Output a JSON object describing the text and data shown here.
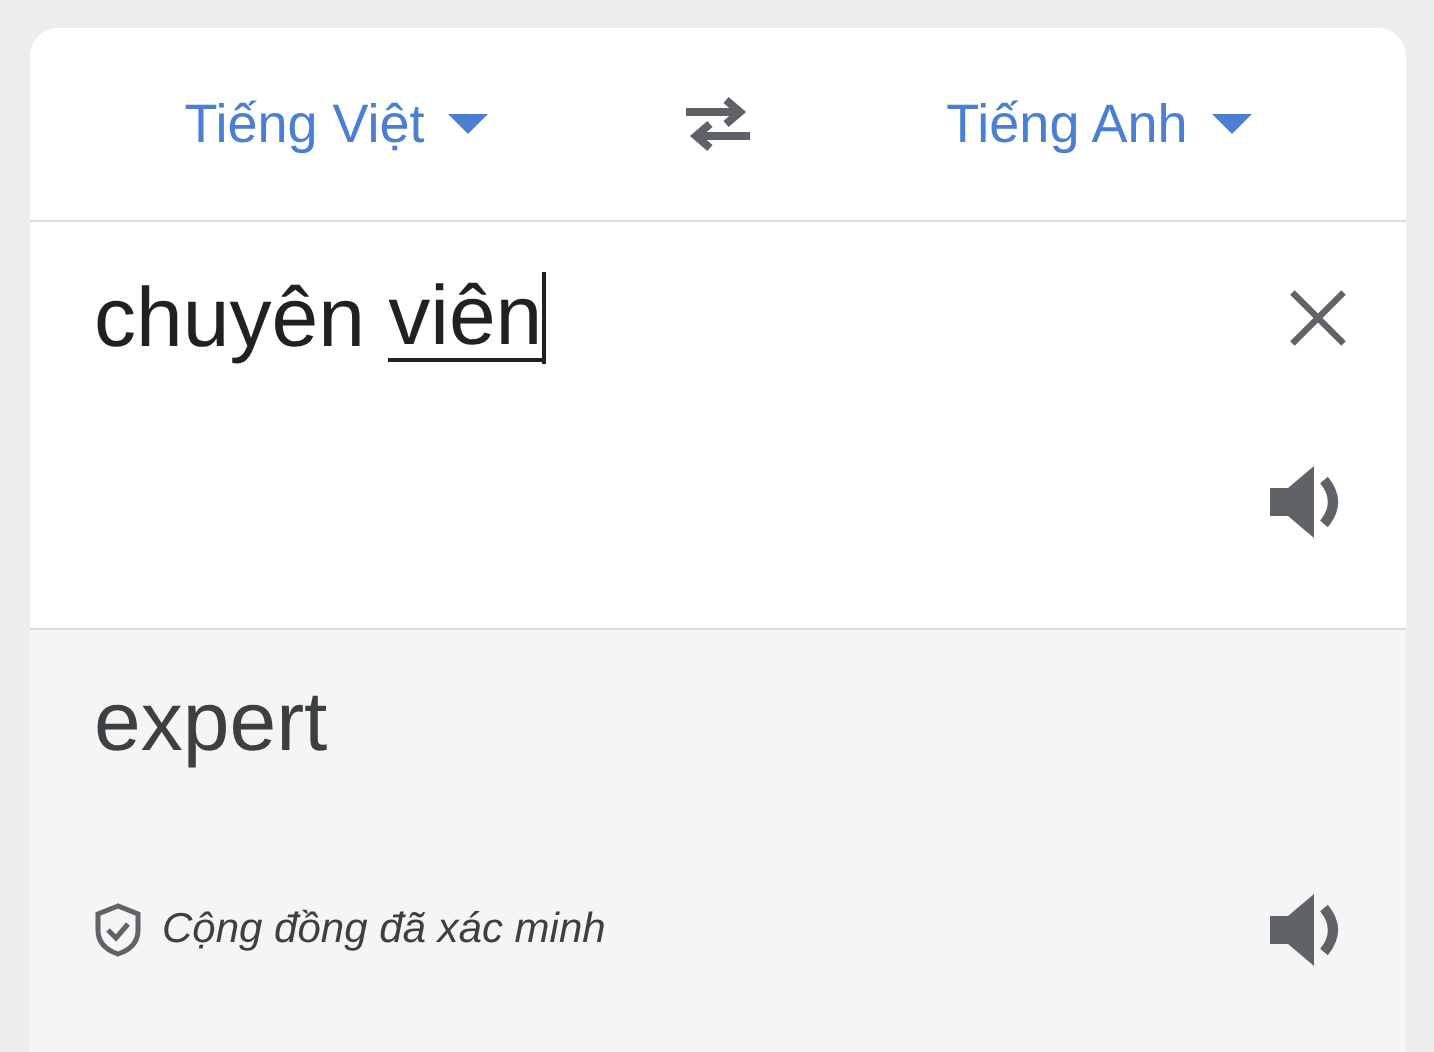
{
  "languages": {
    "source": {
      "label": "Tiếng Việt"
    },
    "target": {
      "label": "Tiếng Anh"
    }
  },
  "input": {
    "text": "chuyên",
    "composing": "viên"
  },
  "output": {
    "text": "expert",
    "badge": "Cộng đồng đã xác minh"
  }
}
